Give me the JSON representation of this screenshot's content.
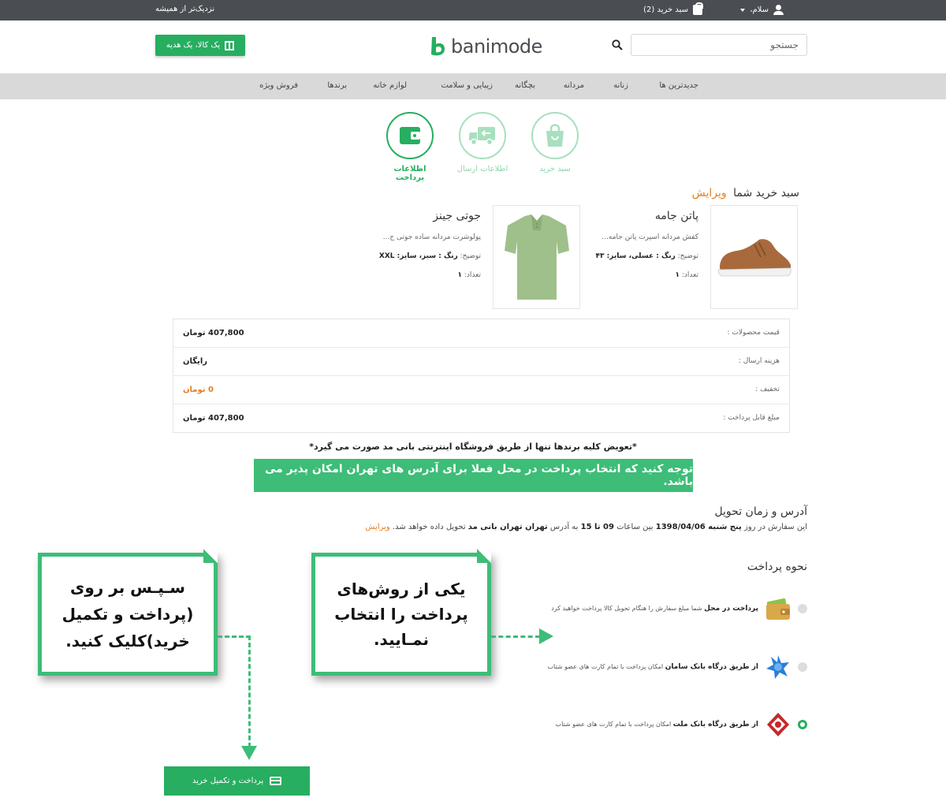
{
  "topbar": {
    "greeting": "سلام،",
    "cart": "سبد خرید (2)",
    "slogan": "نزدیک‌تر از همیشه"
  },
  "header": {
    "search_placeholder": "جستجو",
    "logo_text": "banimode",
    "gift_button": "یک کالا، یک هدیه"
  },
  "nav": {
    "items": [
      "جدیدترین ها",
      "زنانه",
      "مردانه",
      "بچگانه",
      "زیبایی و سلامت",
      "لوازم خانه",
      "برندها",
      "فروش ویژه"
    ]
  },
  "steps": [
    {
      "label": "سبد خرید"
    },
    {
      "label": "اطلاعات ارسال"
    },
    {
      "label": "اطلاعات پرداخت"
    }
  ],
  "cart": {
    "title": "سبد خرید شما",
    "edit": "ویرایش",
    "products": [
      {
        "name": "پاتن جامه",
        "desc": "کفش مردانه اسپرت پاتن جامه...",
        "desc_label": "توضیح:",
        "desc_value": "رنگ : عسلی، سایز: ۴۳",
        "qty_label": "تعداد:",
        "qty": "۱"
      },
      {
        "name": "جوتی جینز",
        "desc": "پولوشرت مردانه ساده جوتی ج...",
        "desc_label": "توضیح:",
        "desc_value": "رنگ : سبز، سایز: XXL",
        "qty_label": "تعداد:",
        "qty": "۱"
      }
    ]
  },
  "summary": [
    {
      "label": "قیمت محصولات :",
      "value": "407,800 تومان"
    },
    {
      "label": "هزینه ارسال :",
      "value": "رایگان"
    },
    {
      "label": "تخفیف :",
      "value": "0 تومان"
    },
    {
      "label": "مبلغ قابل پرداخت :",
      "value": "407,800 تومان"
    }
  ],
  "notice": "*تعویض کلیه برندها تنها از طریق فروشگاه اینترنتی بانی مد صورت می گیرد*",
  "banner": "توجه کنید که انتخاب پرداخت در محل فعلا برای آدرس های تهران امکان پذیر می باشد.",
  "address": {
    "title": "آدرس و زمان تحویل",
    "t1": "این سفارش در روز ",
    "day": "پنج شنبه 1398/04/06",
    "t2": " بین ساعات ",
    "hours": "09 تا 15",
    "t3": " به آدرس ",
    "addr": "تهران تهران بانی مد",
    "t4": " تحویل داده خواهد شد. ",
    "edit": "ویرایش"
  },
  "payment": {
    "title": "نحوه پرداخت",
    "options": [
      {
        "bold": "پرداخت در محل",
        "text": "شما مبلغ سفارش را هنگام تحویل کالا پرداخت خواهید کرد",
        "selected": false
      },
      {
        "bold": "از طریق درگاه بانک سامان",
        "text": "امکان پرداخت با تمام کارت های عضو شتاب",
        "selected": false
      },
      {
        "bold": "از طریق درگاه بانک ملت",
        "text": "امکان پرداخت با تمام کارت های عضو شتاب",
        "selected": true
      }
    ]
  },
  "callouts": {
    "left": "سـپـس بر روی (پرداخت و تکمیل خرید)کلیک کنید.",
    "right": "یکی از روش‌های پرداخت را انتخاب نمـایید."
  },
  "checkout_button": "پرداخت و تکمیل خرید",
  "colors": {
    "accent": "#27ae60",
    "banner": "#3dbd77",
    "edit": "#e67e22",
    "topbar": "#4a4d52",
    "nav": "#d9d9d9"
  }
}
